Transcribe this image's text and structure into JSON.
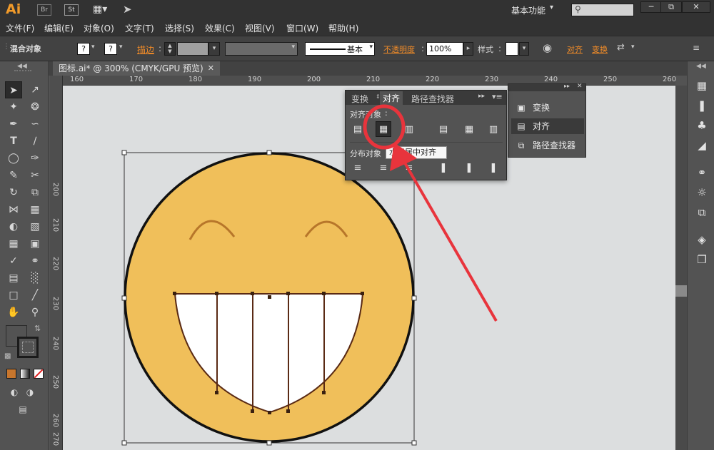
{
  "app": {
    "logo": "Ai",
    "badges": [
      "Br",
      "St"
    ],
    "workspace": "基本功能",
    "search_placeholder": "",
    "window_controls": [
      "minimize-icon",
      "restore-icon",
      "close-icon"
    ]
  },
  "menu": [
    "文件(F)",
    "编辑(E)",
    "对象(O)",
    "文字(T)",
    "选择(S)",
    "效果(C)",
    "视图(V)",
    "窗口(W)",
    "帮助(H)"
  ],
  "control_bar": {
    "object_type": "混合对象",
    "stroke_label": "描边",
    "stroke_style": "基本",
    "opacity_label": "不透明度",
    "opacity_value": "100%",
    "style_label": "样式",
    "align_link": "对齐",
    "transform_link": "变换"
  },
  "document_tab": {
    "title": "图标.ai* @ 300% (CMYK/GPU 预览)"
  },
  "ruler": {
    "h_ticks": [
      "160",
      "170",
      "180",
      "190",
      "200",
      "210",
      "220",
      "230",
      "240",
      "250",
      "260"
    ],
    "v_ticks": [
      "200",
      "210",
      "220",
      "230",
      "240",
      "250",
      "260",
      "270"
    ]
  },
  "align_panel": {
    "tabs": [
      "变换",
      "对齐",
      "路径查找器"
    ],
    "active_tab": "对齐",
    "align_objects_label": "对齐对象",
    "distribute_objects_label": "分布对象",
    "tooltip": "水平居中对齐"
  },
  "dock_panel": {
    "items": [
      {
        "label": "变换",
        "icon": "transform-icon"
      },
      {
        "label": "对齐",
        "icon": "align-icon"
      },
      {
        "label": "路径查找器",
        "icon": "pathfinder-icon"
      }
    ]
  },
  "colors": {
    "face_fill": "#f0bf5a",
    "face_stroke": "#111111",
    "eye_stroke": "#b7762a",
    "tooth_fill": "#ffffff",
    "tooth_stroke": "#5a2a14",
    "annotation_red": "#e8343c",
    "accent_orange": "#f28c28"
  }
}
